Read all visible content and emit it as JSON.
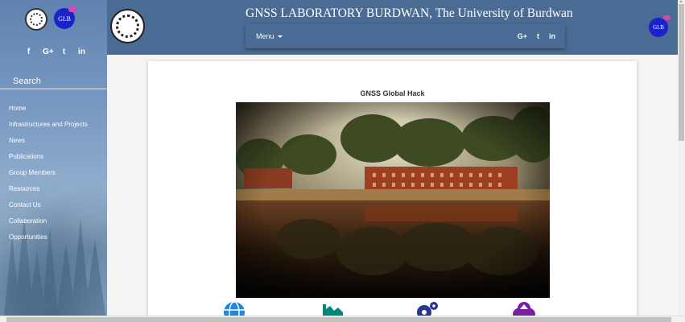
{
  "sidebar": {
    "social": [
      "f",
      "G+",
      "t",
      "in"
    ],
    "search_label": "Search",
    "nav": [
      "Home",
      "Infrastructures and Projects",
      "News",
      "Publications",
      "Group Members",
      "Resources",
      "Contact Us",
      "Collaboration",
      "Opportunities"
    ],
    "logo_text": "GI.B"
  },
  "header": {
    "title": "GNSS LABORATORY BURDWAN, The University of Burdwan",
    "menu_label": "Menu",
    "social": [
      "G+",
      "t",
      "in"
    ],
    "logo_text": "GI.B"
  },
  "main": {
    "card_title": "GNSS Global Hack",
    "feature_icons": [
      "globe-icon",
      "chart-icon",
      "gears-icon",
      "cloud-upload-icon"
    ]
  },
  "colors": {
    "header_bg": "#4a6b93",
    "sidebar_top": "#5f82b0",
    "icon_blue": "#1e88e5",
    "icon_teal": "#00897b",
    "icon_navy": "#283593",
    "icon_purple": "#7b1fa2"
  }
}
